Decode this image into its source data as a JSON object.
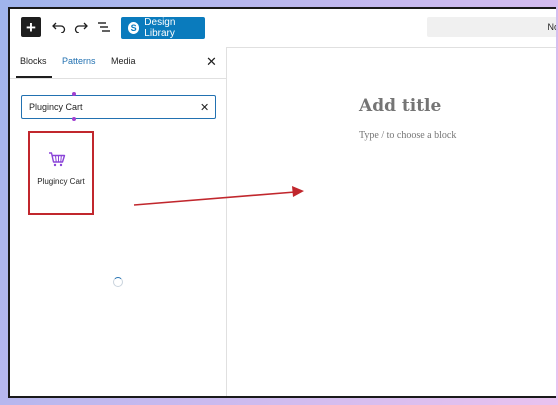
{
  "toolbar": {
    "design_library_label": "Design Library",
    "design_library_logo": "S",
    "document_bar_text": "No"
  },
  "sidebar": {
    "tabs": [
      {
        "label": "Blocks",
        "active": true
      },
      {
        "label": "Patterns",
        "active": false
      },
      {
        "label": "Media",
        "active": false
      }
    ],
    "search": {
      "value": "Plugincy Cart"
    },
    "results": [
      {
        "label": "Plugincy Cart",
        "icon": "cart-icon"
      }
    ]
  },
  "editor": {
    "title_placeholder": "Add title",
    "block_placeholder": "Type / to choose a block"
  },
  "colors": {
    "accent": "#2271b1",
    "design_library": "#0a7bbd",
    "highlight_box": "#c1272d",
    "arrow": "#c1272d",
    "cart_icon": "#8a44d8"
  }
}
